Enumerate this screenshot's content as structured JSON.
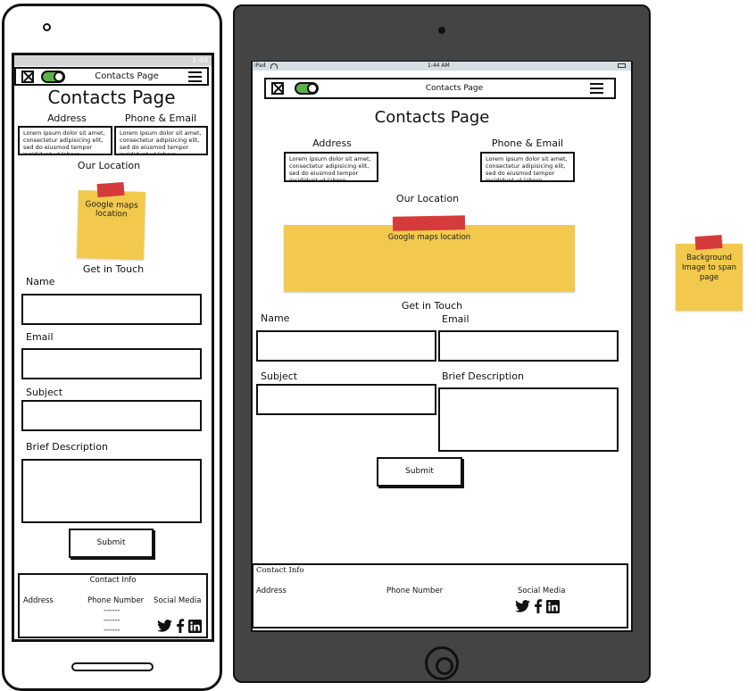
{
  "phone": {
    "status_time": "1:44",
    "nav_title": "Contacts Page",
    "page_title": "Contacts Page",
    "address_label": "Address",
    "phone_email_label": "Phone & Email",
    "lorem": "Lorem ipsum dolor sit amet, consectetur adipisicing elit, sed do eiusmod tempor incididunt ut labore",
    "location_label": "Our Location",
    "map_note": "Google maps location",
    "get_in_touch": "Get in Touch",
    "name_label": "Name",
    "email_label": "Email",
    "subject_label": "Subject",
    "description_label": "Brief Description",
    "submit": "Submit",
    "footer": {
      "title": "Contact Info",
      "address": "Address",
      "phone_number": "Phone Number",
      "dashes": [
        "------",
        "------",
        "------"
      ],
      "social_media": "Social Media"
    }
  },
  "tablet": {
    "status_device": "iPad",
    "status_time": "1:44 AM",
    "nav_title": "Contacts Page",
    "page_title": "Contacts Page",
    "address_label": "Address",
    "phone_email_label": "Phone & Email",
    "lorem": "Lorem ipsum dolor sit amet, consectetur adipisicing elit, sed do eiusmod tempor incididunt ut labore",
    "location_label": "Our Location",
    "map_note": "Google maps location",
    "get_in_touch": "Get in Touch",
    "name_label": "Name",
    "email_label": "Email",
    "subject_label": "Subject",
    "description_label": "Brief Description",
    "submit": "Submit",
    "footer": {
      "title": "Contact Info",
      "address": "Address",
      "phone_number": "Phone Number",
      "social_media": "Social Media"
    }
  },
  "side_note": "Background Image to span page",
  "colors": {
    "note_yellow": "#f2c94c",
    "tape_red": "#d63b3b",
    "toggle_green": "#5fb04a",
    "tablet_body": "#444444"
  },
  "icons": [
    "close-icon",
    "toggle-switch",
    "hamburger-menu-icon",
    "twitter-icon",
    "facebook-icon",
    "linkedin-icon",
    "wifi-icon",
    "battery-icon"
  ]
}
